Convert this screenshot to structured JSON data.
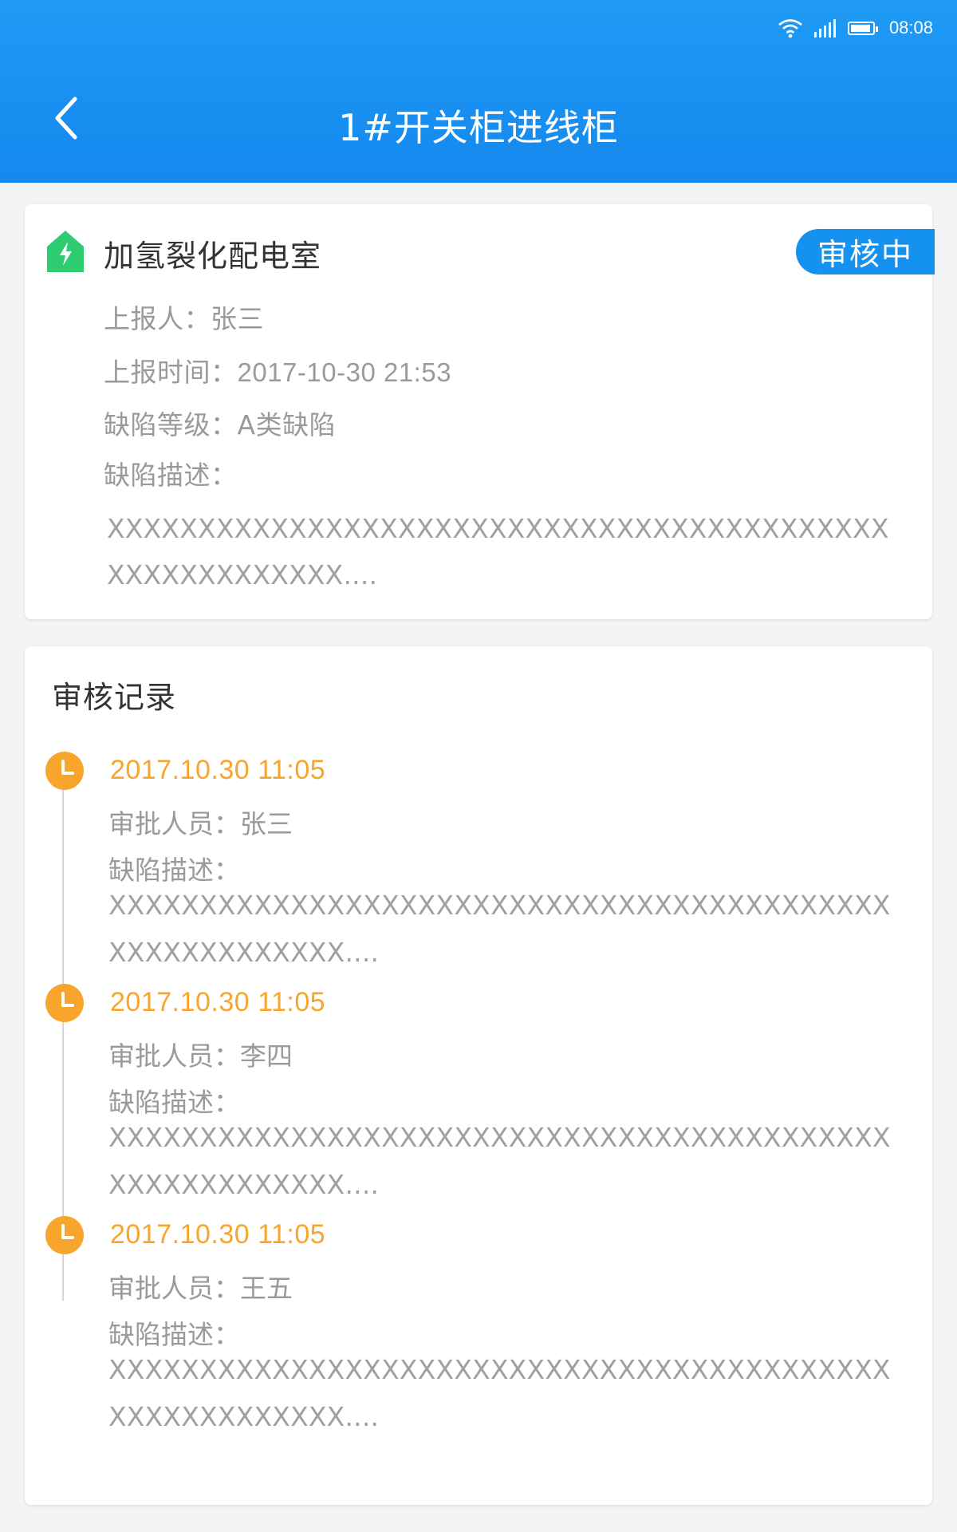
{
  "status_bar": {
    "time": "08:08"
  },
  "header": {
    "title": "1#开关柜进线柜"
  },
  "report": {
    "room": "加氢裂化配电室",
    "status": "审核中",
    "reporter_label": "上报人：",
    "reporter": "张三",
    "time_label": "上报时间：",
    "time": "2017-10-30 21:53",
    "level_label": "缺陷等级：",
    "level": "A类缺陷",
    "desc_label": "缺陷描述：",
    "desc": "XXXXXXXXXXXXXXXXXXXXXXXXXXXXXXXXXXXXXXXXXXXXXXXXXXXXXXXX...."
  },
  "audit": {
    "title": "审核记录",
    "records": [
      {
        "time": "2017.10.30 11:05",
        "approver_label": "审批人员：",
        "approver": "张三",
        "desc_label": "缺陷描述：",
        "desc": "XXXXXXXXXXXXXXXXXXXXXXXXXXXXXXXXXXXXXXXXXXXXXXXXXXXXXXXX...."
      },
      {
        "time": "2017.10.30 11:05",
        "approver_label": "审批人员：",
        "approver": "李四",
        "desc_label": "缺陷描述：",
        "desc": "XXXXXXXXXXXXXXXXXXXXXXXXXXXXXXXXXXXXXXXXXXXXXXXXXXXXXXXX...."
      },
      {
        "time": "2017.10.30 11:05",
        "approver_label": "审批人员：",
        "approver": "王五",
        "desc_label": "缺陷描述：",
        "desc": "XXXXXXXXXXXXXXXXXXXXXXXXXXXXXXXXXXXXXXXXXXXXXXXXXXXXXXXX...."
      }
    ]
  },
  "colors": {
    "primary": "#1591f0",
    "accent_orange": "#f7a52d",
    "icon_green": "#2ecc71"
  }
}
